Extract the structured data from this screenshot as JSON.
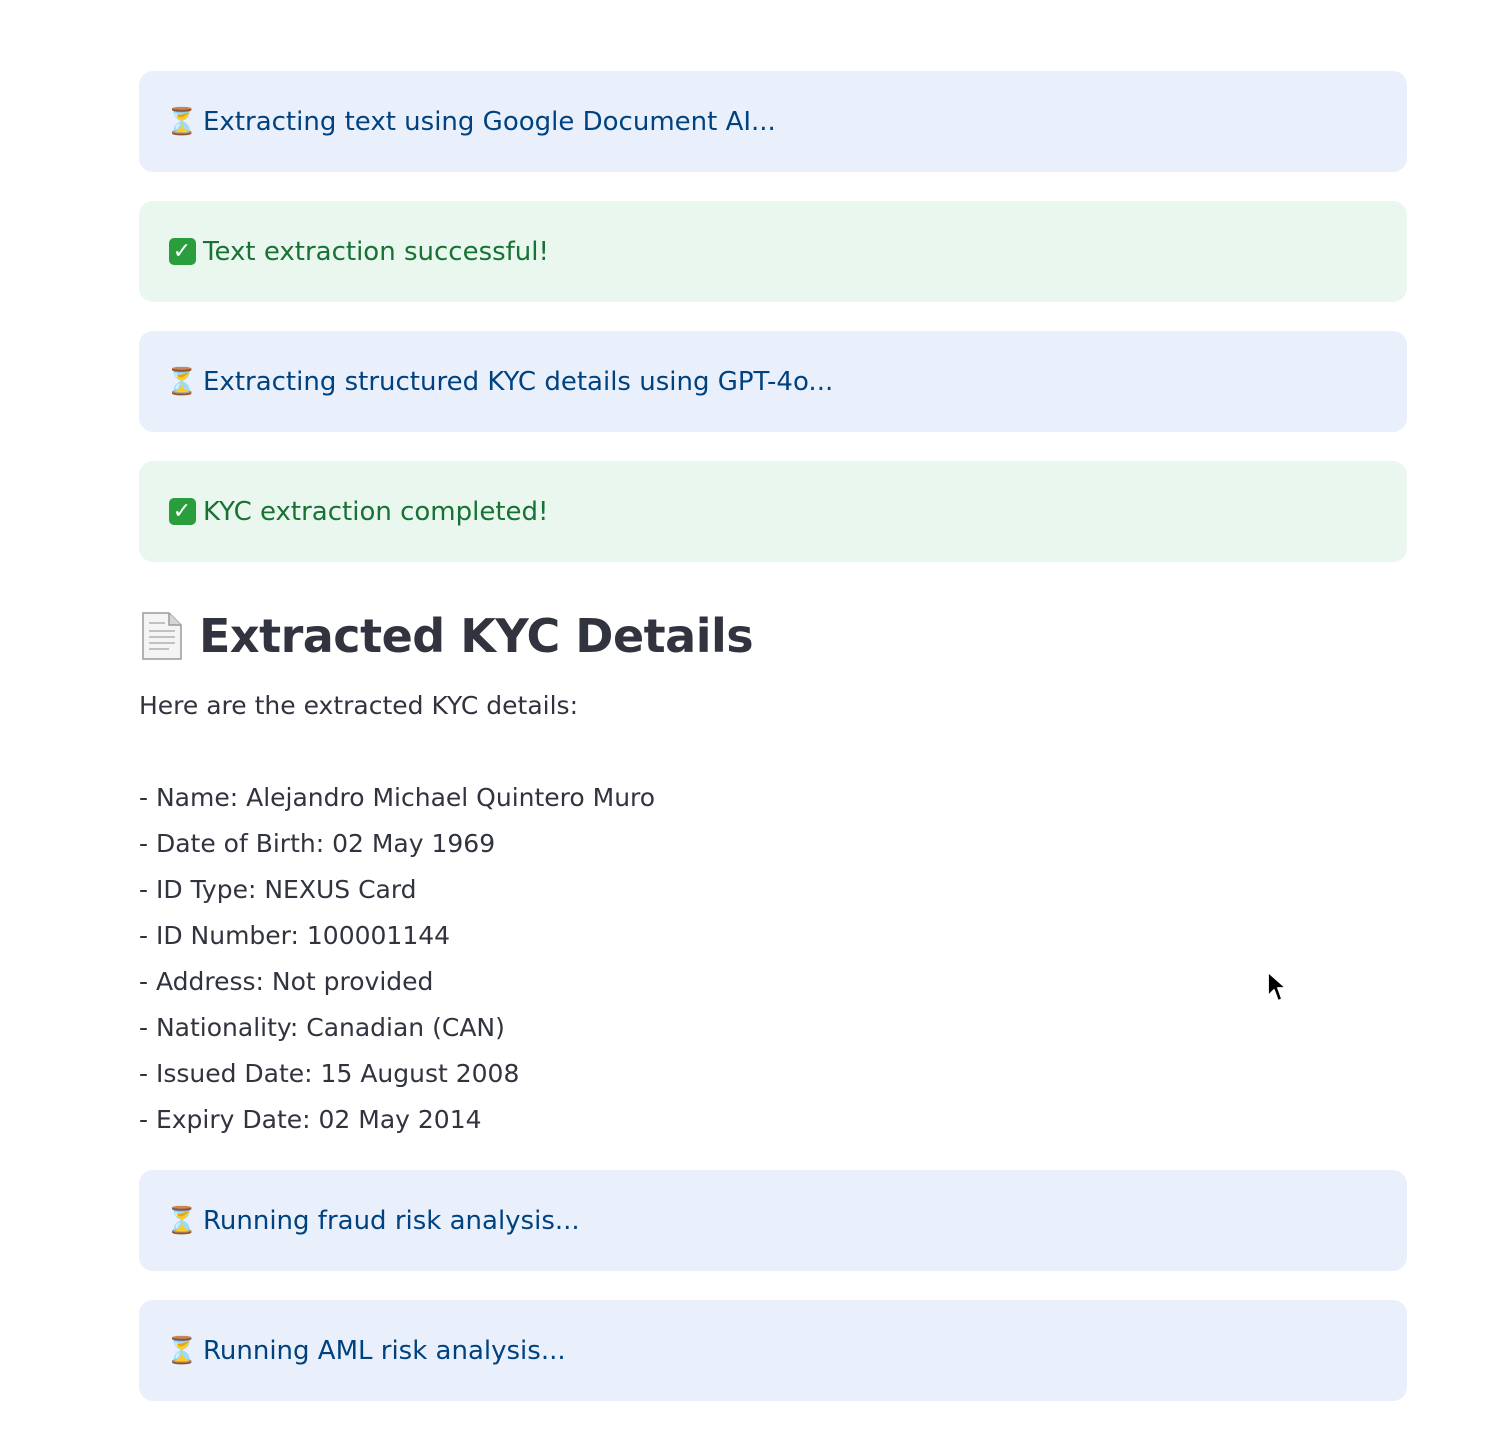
{
  "status_messages_top": [
    {
      "type": "info",
      "icon": "hourglass-icon",
      "text": "Extracting text using Google Document AI..."
    },
    {
      "type": "success",
      "icon": "checkmark-icon",
      "text": "Text extraction successful!"
    },
    {
      "type": "info",
      "icon": "hourglass-icon",
      "text": "Extracting structured KYC details using GPT-4o..."
    },
    {
      "type": "success",
      "icon": "checkmark-icon",
      "text": "KYC extraction completed!"
    }
  ],
  "section": {
    "icon": "document-icon",
    "title": "Extracted KYC Details",
    "intro": "Here are the extracted KYC details:",
    "details": [
      "- Name: Alejandro Michael Quintero Muro",
      "- Date of Birth: 02 May 1969",
      "- ID Type: NEXUS Card",
      "- ID Number: 100001144",
      "- Address: Not provided",
      "- Nationality: Canadian (CAN)",
      "- Issued Date: 15 August 2008",
      "- Expiry Date: 02 May 2014"
    ]
  },
  "status_messages_bottom": [
    {
      "type": "info",
      "icon": "hourglass-icon",
      "text": "Running fraud risk analysis..."
    },
    {
      "type": "info",
      "icon": "hourglass-icon",
      "text": "Running AML risk analysis..."
    }
  ],
  "colors": {
    "info_bg": "#e9f0fb",
    "info_text": "#004280",
    "success_bg": "#e9f7ee",
    "success_text": "#177233",
    "body_text": "#31333f"
  }
}
